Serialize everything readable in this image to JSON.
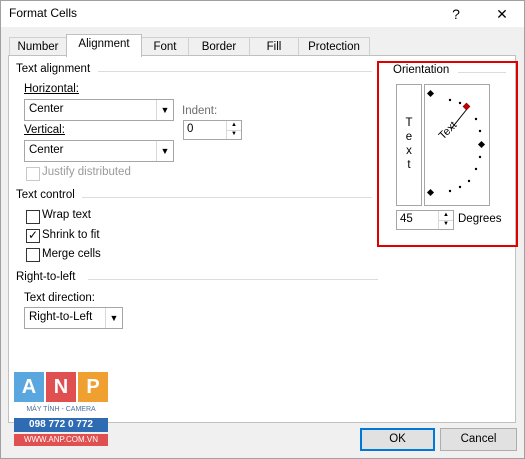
{
  "window": {
    "title": "Format Cells",
    "help_label": "?",
    "close_label": "✕"
  },
  "tabs": [
    "Number",
    "Alignment",
    "Font",
    "Border",
    "Fill",
    "Protection"
  ],
  "text_alignment": {
    "heading": "Text alignment",
    "horizontal_label": "Horizontal:",
    "horizontal_value": "Center",
    "vertical_label": "Vertical:",
    "vertical_value": "Center",
    "indent_label": "Indent:",
    "indent_value": "0",
    "justify_distributed_label": "Justify distributed"
  },
  "text_control": {
    "heading": "Text control",
    "wrap_text_label": "Wrap text",
    "wrap_text_checked": false,
    "shrink_to_fit_label": "Shrink to fit",
    "shrink_to_fit_checked": true,
    "merge_cells_label": "Merge cells",
    "merge_cells_checked": false
  },
  "right_to_left": {
    "heading": "Right-to-left",
    "text_direction_label": "Text direction:",
    "text_direction_value": "Right-to-Left"
  },
  "orientation": {
    "heading": "Orientation",
    "vertical_text": [
      "T",
      "e",
      "x",
      "t"
    ],
    "dial_text": "Text",
    "degrees_value": "45",
    "degrees_label": "Degrees",
    "angle": 45,
    "highlight_color": "#e00000"
  },
  "buttons": {
    "ok_label": "OK",
    "cancel_label": "Cancel"
  },
  "watermark": {
    "letters": [
      "A",
      "N",
      "P"
    ],
    "tagline": "MÁY TÍNH - CAMERA",
    "phone": "098 772 0 772",
    "website": "WWW.ANP.COM.VN"
  }
}
